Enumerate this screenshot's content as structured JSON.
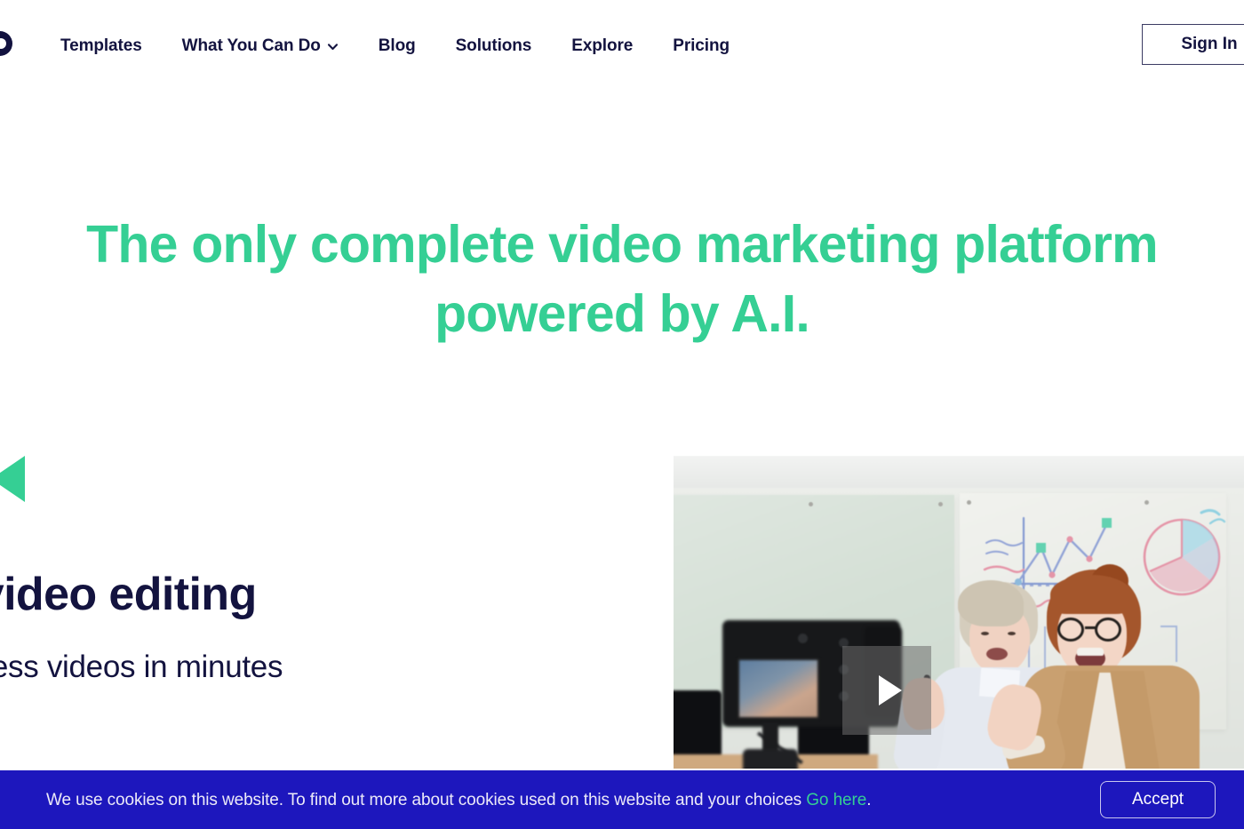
{
  "brand": {
    "logo_icon": "circular-logo-mark"
  },
  "nav": {
    "items": [
      {
        "label": "Templates",
        "has_dropdown": false
      },
      {
        "label": "What You Can Do",
        "has_dropdown": true,
        "dropdown_icon": "chevron-down-icon"
      },
      {
        "label": "Blog",
        "has_dropdown": false
      },
      {
        "label": "Solutions",
        "has_dropdown": false
      },
      {
        "label": "Explore",
        "has_dropdown": false
      },
      {
        "label": "Pricing",
        "has_dropdown": false
      }
    ],
    "sign_in_label": "Sign In"
  },
  "hero": {
    "headline": "The only complete video marketing platform powered by A.I.",
    "headline_color": "#35cf94"
  },
  "carousel": {
    "prev_icon": "triangle-left-icon",
    "prev_color": "#35cf94"
  },
  "feature": {
    "title": "Simple video editing",
    "subtitle": "Create business videos in minutes",
    "text_color": "#13133f"
  },
  "video": {
    "play_icon": "play-triangle-icon",
    "alt": "Two women recording a video in an office with a camera on a tripod and whiteboards behind them"
  },
  "cookies": {
    "text_before": "We use cookies on this website. To find out more about cookies used on this website and your choices ",
    "link_label": "Go here",
    "text_after": ".",
    "accept_label": "Accept",
    "background": "#1d17bd",
    "link_color": "#35cf94"
  }
}
